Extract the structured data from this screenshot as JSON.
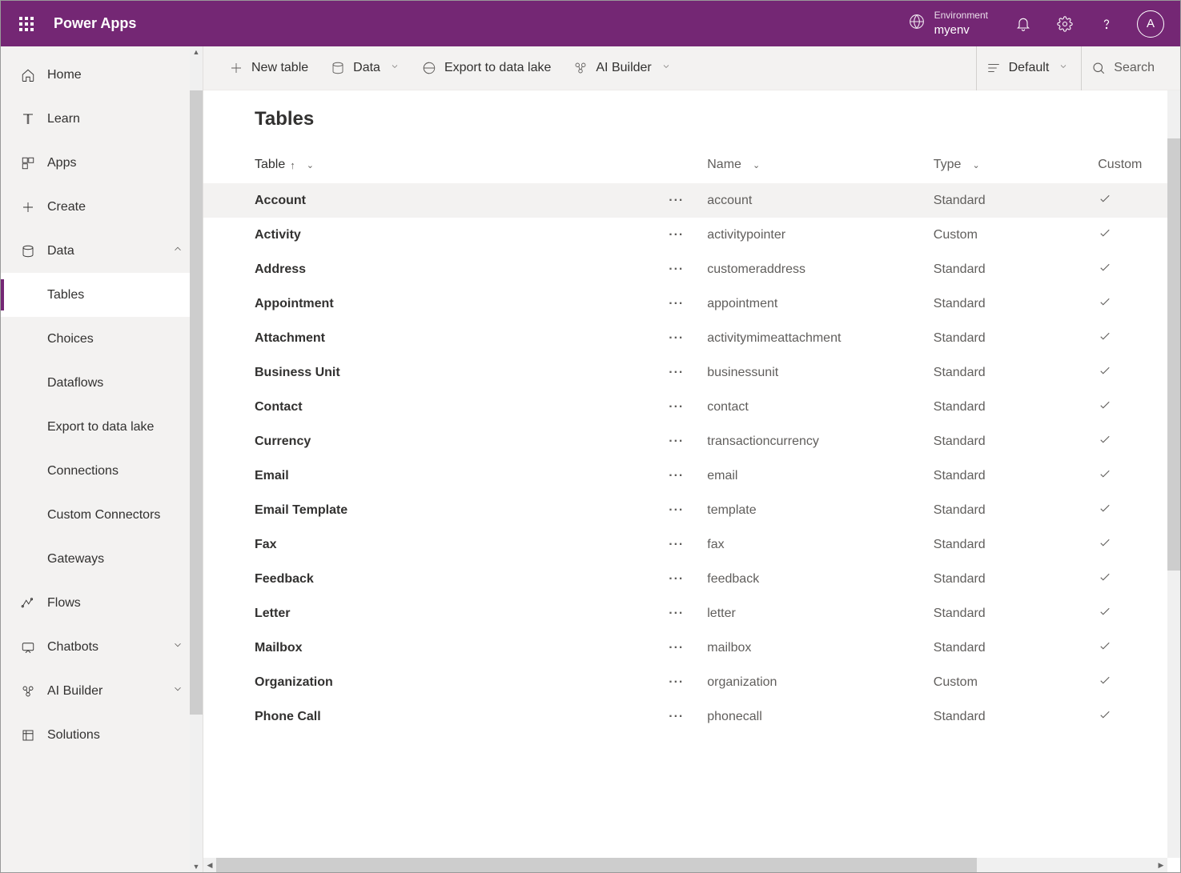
{
  "header": {
    "appTitle": "Power Apps",
    "envLabel": "Environment",
    "envName": "myenv",
    "avatarInitial": "A"
  },
  "sidebar": {
    "items": [
      {
        "label": "Home"
      },
      {
        "label": "Learn"
      },
      {
        "label": "Apps"
      },
      {
        "label": "Create"
      },
      {
        "label": "Data"
      },
      {
        "label": "Tables"
      },
      {
        "label": "Choices"
      },
      {
        "label": "Dataflows"
      },
      {
        "label": "Export to data lake"
      },
      {
        "label": "Connections"
      },
      {
        "label": "Custom Connectors"
      },
      {
        "label": "Gateways"
      },
      {
        "label": "Flows"
      },
      {
        "label": "Chatbots"
      },
      {
        "label": "AI Builder"
      },
      {
        "label": "Solutions"
      }
    ]
  },
  "commandbar": {
    "newTable": "New table",
    "data": "Data",
    "exportLake": "Export to data lake",
    "aiBuilder": "AI Builder",
    "default": "Default",
    "search": "Search"
  },
  "page": {
    "title": "Tables",
    "columns": {
      "table": "Table",
      "name": "Name",
      "type": "Type",
      "custom": "Custom"
    },
    "rows": [
      {
        "table": "Account",
        "name": "account",
        "type": "Standard",
        "custom": true
      },
      {
        "table": "Activity",
        "name": "activitypointer",
        "type": "Custom",
        "custom": true
      },
      {
        "table": "Address",
        "name": "customeraddress",
        "type": "Standard",
        "custom": true
      },
      {
        "table": "Appointment",
        "name": "appointment",
        "type": "Standard",
        "custom": true
      },
      {
        "table": "Attachment",
        "name": "activitymimeattachment",
        "type": "Standard",
        "custom": true
      },
      {
        "table": "Business Unit",
        "name": "businessunit",
        "type": "Standard",
        "custom": true
      },
      {
        "table": "Contact",
        "name": "contact",
        "type": "Standard",
        "custom": true
      },
      {
        "table": "Currency",
        "name": "transactioncurrency",
        "type": "Standard",
        "custom": true
      },
      {
        "table": "Email",
        "name": "email",
        "type": "Standard",
        "custom": true
      },
      {
        "table": "Email Template",
        "name": "template",
        "type": "Standard",
        "custom": true
      },
      {
        "table": "Fax",
        "name": "fax",
        "type": "Standard",
        "custom": true
      },
      {
        "table": "Feedback",
        "name": "feedback",
        "type": "Standard",
        "custom": true
      },
      {
        "table": "Letter",
        "name": "letter",
        "type": "Standard",
        "custom": true
      },
      {
        "table": "Mailbox",
        "name": "mailbox",
        "type": "Standard",
        "custom": true
      },
      {
        "table": "Organization",
        "name": "organization",
        "type": "Custom",
        "custom": true
      },
      {
        "table": "Phone Call",
        "name": "phonecall",
        "type": "Standard",
        "custom": true
      }
    ]
  }
}
